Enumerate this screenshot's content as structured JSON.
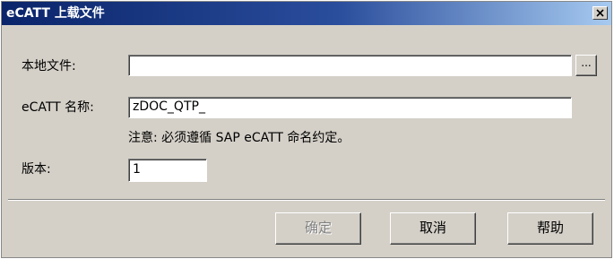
{
  "window": {
    "title": "eCATT 上载文件",
    "close_glyph": "✕"
  },
  "form": {
    "local_file_label": "本地文件:",
    "local_file_value": "",
    "browse_label": "...",
    "ecatt_name_label": "eCATT 名称:",
    "ecatt_name_value": "zDOC_QTP_",
    "note": "注意: 必须遵循 SAP eCATT 命名约定。",
    "version_label": "版本:",
    "version_value": "1"
  },
  "buttons": {
    "ok_label": "确定",
    "ok_enabled": false,
    "cancel_label": "取消",
    "help_label": "帮助"
  },
  "colors": {
    "dialog_background": "#d4d0c8",
    "titlebar_start": "#0a246a",
    "titlebar_end": "#a6caf0",
    "disabled_text": "#808080"
  }
}
